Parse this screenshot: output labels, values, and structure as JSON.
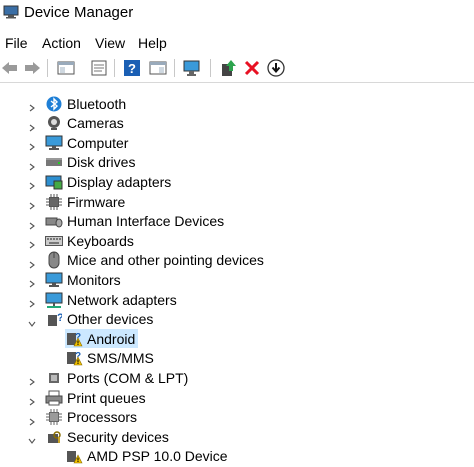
{
  "window": {
    "title": "Device Manager"
  },
  "menu": [
    {
      "label": "File"
    },
    {
      "label": "Action"
    },
    {
      "label": "View"
    },
    {
      "label": "Help"
    }
  ],
  "toolbar": [
    {
      "icon": "back-arrow-icon"
    },
    {
      "icon": "forward-arrow-icon"
    },
    {
      "icon": "show-hide-console-tree-icon"
    },
    {
      "icon": "properties-icon"
    },
    {
      "icon": "help-icon"
    },
    {
      "icon": "action-pane-icon"
    },
    {
      "icon": "scan-hardware-changes-icon"
    },
    {
      "icon": "update-driver-icon"
    },
    {
      "icon": "uninstall-device-icon"
    },
    {
      "icon": "disable-device-icon"
    }
  ],
  "tree": {
    "categories": [
      {
        "label": "Bluetooth",
        "icon": "bluetooth-icon",
        "expanded": false
      },
      {
        "label": "Cameras",
        "icon": "camera-icon",
        "expanded": false
      },
      {
        "label": "Computer",
        "icon": "computer-icon",
        "expanded": false
      },
      {
        "label": "Disk drives",
        "icon": "disk-drive-icon",
        "expanded": false
      },
      {
        "label": "Display adapters",
        "icon": "display-adapter-icon",
        "expanded": false
      },
      {
        "label": "Firmware",
        "icon": "firmware-icon",
        "expanded": false
      },
      {
        "label": "Human Interface Devices",
        "icon": "hid-icon",
        "expanded": false
      },
      {
        "label": "Keyboards",
        "icon": "keyboard-icon",
        "expanded": false
      },
      {
        "label": "Mice and other pointing devices",
        "icon": "mouse-icon",
        "expanded": false
      },
      {
        "label": "Monitors",
        "icon": "monitor-icon",
        "expanded": false
      },
      {
        "label": "Network adapters",
        "icon": "network-adapter-icon",
        "expanded": false
      },
      {
        "label": "Other devices",
        "icon": "other-devices-icon",
        "expanded": true,
        "children": [
          {
            "label": "Android",
            "icon": "unknown-device-warning-icon",
            "selected": true
          },
          {
            "label": "SMS/MMS",
            "icon": "unknown-device-warning-icon",
            "selected": false
          }
        ]
      },
      {
        "label": "Ports (COM & LPT)",
        "icon": "port-icon",
        "expanded": false
      },
      {
        "label": "Print queues",
        "icon": "printer-icon",
        "expanded": false
      },
      {
        "label": "Processors",
        "icon": "processor-icon",
        "expanded": false
      },
      {
        "label": "Security devices",
        "icon": "security-device-icon",
        "expanded": true,
        "children": [
          {
            "label": "AMD PSP 10.0 Device",
            "icon": "security-device-item-icon",
            "selected": false
          }
        ]
      }
    ]
  },
  "colors": {
    "selection": "#cce8ff",
    "accent": "#0078d7",
    "warning": "#f2c200",
    "delete_red": "#e81123"
  }
}
